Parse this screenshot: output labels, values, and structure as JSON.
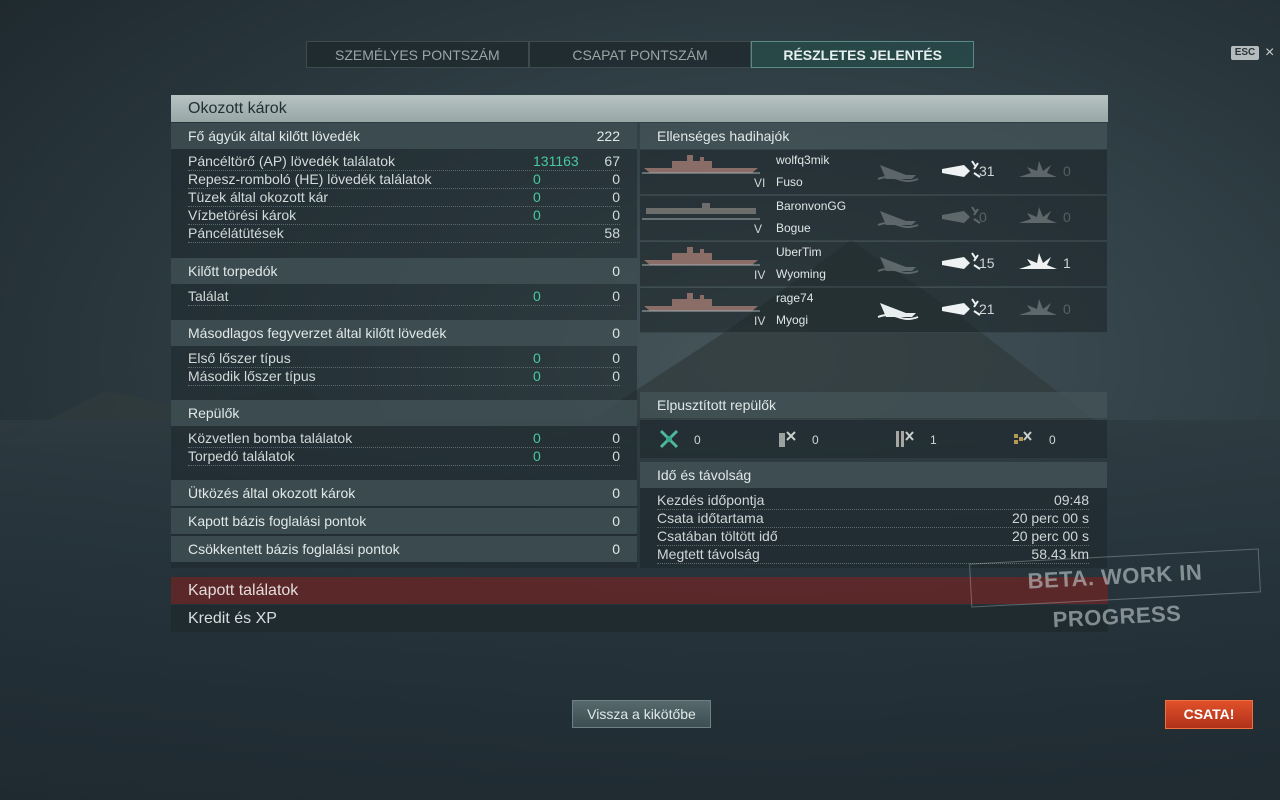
{
  "tabs": [
    "SZEMÉLYES PONTSZÁM",
    "CSAPAT PONTSZÁM",
    "RÉSZLETES JELENTÉS"
  ],
  "esc_label": "ESC",
  "close_label": "×",
  "damage_section": {
    "title": "Okozott károk",
    "main_guns": {
      "label": "Fő ágyúk által kilőtt lövedék",
      "value": "222"
    },
    "main_rows": [
      {
        "label": "Páncéltörő (AP) lövedék találatok",
        "damage": "131163",
        "count": "67"
      },
      {
        "label": "Repesz-romboló (HE) lövedék találatok",
        "damage": "0",
        "count": "0"
      },
      {
        "label": "Tüzek által okozott kár",
        "damage": "0",
        "count": "0"
      },
      {
        "label": "Vízbetörési károk",
        "damage": "0",
        "count": "0"
      },
      {
        "label": "Páncélátütések",
        "damage": "",
        "count": "58"
      }
    ],
    "torpedoes": {
      "label": "Kilőtt torpedók",
      "value": "0"
    },
    "torpedo_rows": [
      {
        "label": "Találat",
        "damage": "0",
        "count": "0"
      }
    ],
    "secondary": {
      "label": "Másodlagos fegyverzet által kilőtt lövedék",
      "value": "0"
    },
    "secondary_rows": [
      {
        "label": "Első lőszer típus",
        "damage": "0",
        "count": "0"
      },
      {
        "label": "Második lőszer típus",
        "damage": "0",
        "count": "0"
      }
    ],
    "planes": {
      "label": "Repülők"
    },
    "plane_rows": [
      {
        "label": "Közvetlen bomba találatok",
        "damage": "0",
        "count": "0"
      },
      {
        "label": "Torpedó találatok",
        "damage": "0",
        "count": "0"
      }
    ],
    "ramming": {
      "label": "Ütközés által okozott károk",
      "value": "0"
    },
    "capture": {
      "label": "Kapott bázis foglalási pontok",
      "value": "0"
    },
    "decapture": {
      "label": "Csökkentett bázis foglalási pontok",
      "value": "0"
    }
  },
  "enemy_ships": {
    "title": "Ellenséges hadihajók",
    "ships": [
      {
        "tier": "VI",
        "player": "wolfq3mik",
        "ship": "Fuso",
        "sunk": false,
        "hits": "31",
        "hits_active": true,
        "fires": "0",
        "fires_active": false
      },
      {
        "tier": "V",
        "player": "BaronvonGG",
        "ship": "Bogue",
        "sunk": false,
        "hits": "0",
        "hits_active": false,
        "fires": "0",
        "fires_active": false
      },
      {
        "tier": "IV",
        "player": "UberTim",
        "ship": "Wyoming",
        "sunk": false,
        "hits": "15",
        "hits_active": true,
        "fires": "1",
        "fires_active": true
      },
      {
        "tier": "IV",
        "player": "rage74",
        "ship": "Myogi",
        "sunk": true,
        "hits": "21",
        "hits_active": true,
        "fires": "0",
        "fires_active": false
      }
    ]
  },
  "planes_destroyed": {
    "title": "Elpusztított repülők",
    "items": [
      {
        "icon": "fighter-icon",
        "value": "0"
      },
      {
        "icon": "bomber-icon",
        "value": "0"
      },
      {
        "icon": "torpedo-bomber-icon",
        "value": "1"
      },
      {
        "icon": "dive-bomber-icon",
        "value": "0"
      }
    ]
  },
  "time_distance": {
    "title": "Idő és távolság",
    "rows": [
      {
        "label": "Kezdés időpontja",
        "value": "09:48"
      },
      {
        "label": "Csata időtartama",
        "value": "20 perc 00 s"
      },
      {
        "label": "Csatában töltött idő",
        "value": "20 perc 00 s"
      },
      {
        "label": "Megtett távolság",
        "value": "58.43 km"
      }
    ]
  },
  "received_hits": "Kapott találatok",
  "credit_xp": "Kredit és XP",
  "watermark": "BETA. WORK IN PROGRESS",
  "back_button": "Vissza a kikötőbe",
  "battle_button": "CSATA!",
  "colors": {
    "accent_green": "#49c9a0",
    "battle_red": "#c8401f",
    "section_header": "#a9b6b6"
  }
}
